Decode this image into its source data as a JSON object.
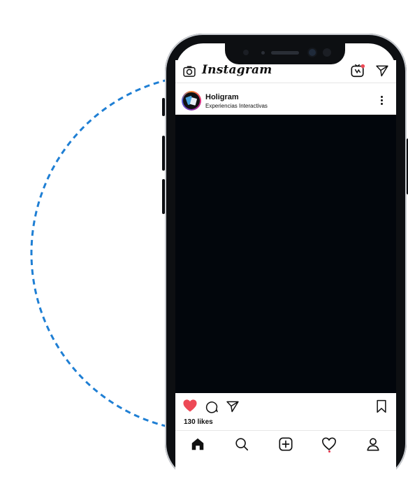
{
  "header": {
    "app_name": "Instagram",
    "icons": [
      "camera-icon",
      "igtv-icon",
      "direct-send-icon"
    ]
  },
  "post": {
    "username": "Holigram",
    "subtitle": "Experiencias Interactivas",
    "likes": "130 likes",
    "liked": true
  },
  "colors": {
    "accent_dashed_circle": "#1f7fd4",
    "like_red": "#ed4956",
    "media_background": "#02060c",
    "phone_frame": "#0d0f12"
  },
  "bottom_nav": {
    "items": [
      "home-icon",
      "search-icon",
      "add-post-icon",
      "activity-heart-icon",
      "profile-icon"
    ],
    "active": "home-icon"
  }
}
